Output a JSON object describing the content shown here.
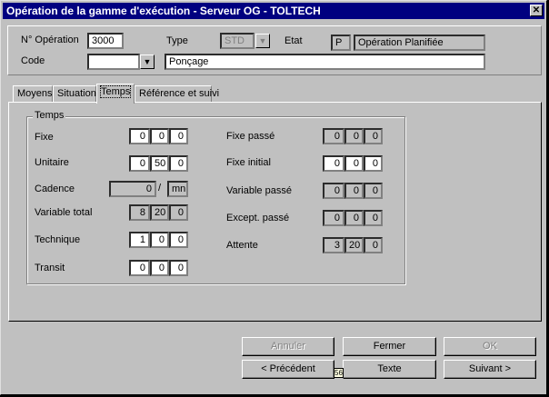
{
  "window": {
    "title": "Opération de la gamme d'exécution - Serveur OG - TOLTECH",
    "close_label": "✕"
  },
  "header": {
    "operation_label": "N° Opération",
    "operation_value": "3000",
    "type_label": "Type",
    "type_value": "STD",
    "etat_label": "Etat",
    "etat_code": "P",
    "etat_desc": "Opération Planifiée",
    "code_label": "Code",
    "code_value": "",
    "code_desc": "Ponçage"
  },
  "tabs": [
    {
      "label": "Moyens"
    },
    {
      "label": "Situation"
    },
    {
      "label": "Temps"
    },
    {
      "label": "Référence et suivi"
    }
  ],
  "temps": {
    "group_label": "Temps",
    "fixe": {
      "label": "Fixe",
      "v": [
        "0",
        "0",
        "0"
      ]
    },
    "unitaire": {
      "label": "Unitaire",
      "v": [
        "0",
        "50",
        "0"
      ]
    },
    "cadence": {
      "label": "Cadence",
      "value": "0",
      "sep": "/",
      "unit": "mn"
    },
    "variable_total": {
      "label": "Variable total",
      "v": [
        "8",
        "20",
        "0"
      ]
    },
    "technique": {
      "label": "Technique",
      "v": [
        "1",
        "0",
        "0"
      ]
    },
    "transit": {
      "label": "Transit",
      "v": [
        "0",
        "0",
        "0"
      ]
    },
    "fixe_passe": {
      "label": "Fixe passé",
      "v": [
        "0",
        "0",
        "0"
      ]
    },
    "fixe_initial": {
      "label": "Fixe initial",
      "v": [
        "0",
        "0",
        "0"
      ]
    },
    "variable_passe": {
      "label": "Variable passé",
      "v": [
        "0",
        "0",
        "0"
      ]
    },
    "except_passe": {
      "label": "Except. passé",
      "v": [
        "0",
        "0",
        "0"
      ]
    },
    "attente": {
      "label": "Attente",
      "v": [
        "3",
        "20",
        "0"
      ]
    }
  },
  "buttons": {
    "annuler": "Annuler",
    "fermer": "Fermer",
    "ok": "OK",
    "precedent": "< Précédent",
    "texte": "Texte",
    "suivant": "Suivant >",
    "marker": "56"
  }
}
